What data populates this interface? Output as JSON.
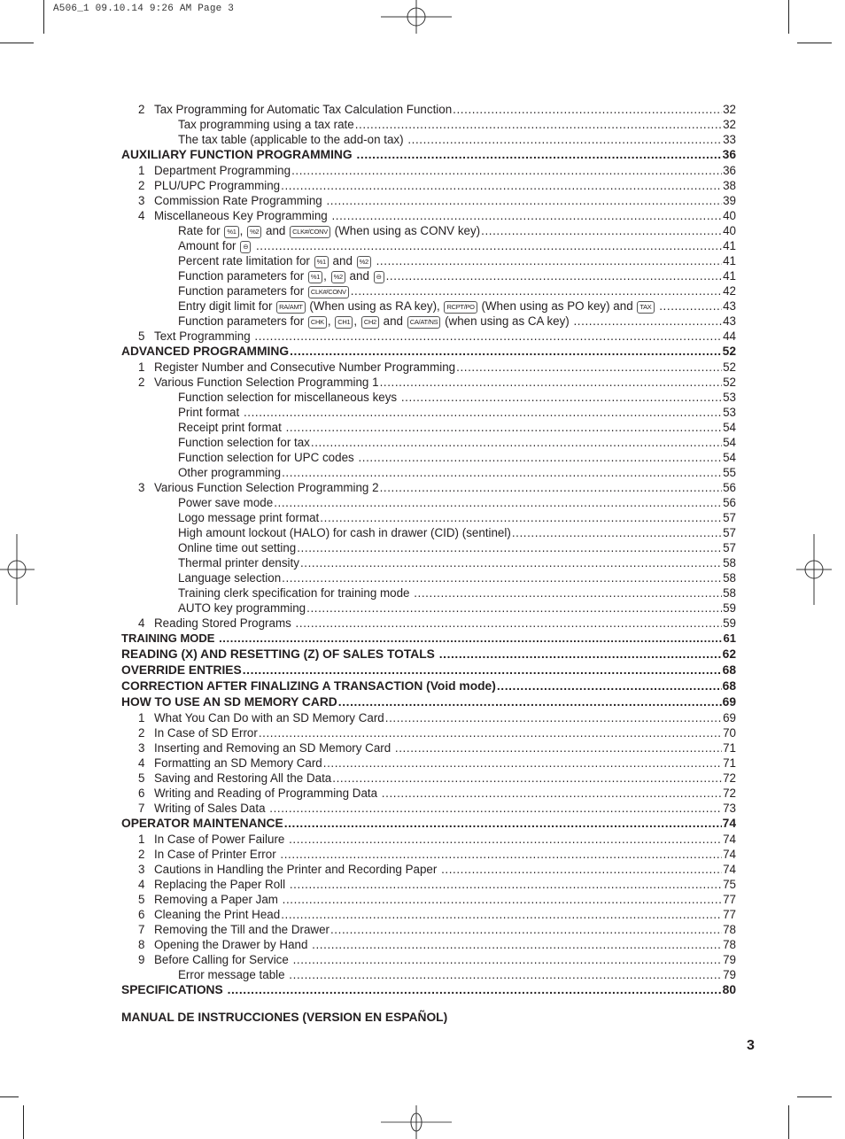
{
  "slug": "A506_1  09.10.14 9:26 AM  Page 3",
  "toc": [
    {
      "level": 1,
      "num": "2",
      "parts": [
        {
          "t": "Tax Programming for Automatic Tax Calculation Function"
        }
      ],
      "page": "32"
    },
    {
      "level": 2,
      "parts": [
        {
          "t": "Tax programming using a tax rate"
        }
      ],
      "page": "32"
    },
    {
      "level": 2,
      "parts": [
        {
          "t": "The tax table (applicable to the add-on tax) "
        }
      ],
      "page": "33"
    },
    {
      "level": 0,
      "parts": [
        {
          "t": "AUXILIARY FUNCTION PROGRAMMING "
        }
      ],
      "page": "36"
    },
    {
      "level": 1,
      "num": "1",
      "parts": [
        {
          "t": "Department Programming"
        }
      ],
      "page": "36"
    },
    {
      "level": 1,
      "num": "2",
      "parts": [
        {
          "t": "PLU/UPC Programming"
        }
      ],
      "page": "38"
    },
    {
      "level": 1,
      "num": "3",
      "parts": [
        {
          "t": "Commission Rate Programming "
        }
      ],
      "page": "39"
    },
    {
      "level": 1,
      "num": "4",
      "parts": [
        {
          "t": "Miscellaneous Key Programming "
        }
      ],
      "page": "40"
    },
    {
      "level": 2,
      "parts": [
        {
          "t": "Rate for "
        },
        {
          "k": "%1"
        },
        {
          "t": ", "
        },
        {
          "k": "%2"
        },
        {
          "t": " and "
        },
        {
          "k": "CLK#/CONV"
        },
        {
          "t": " (When using as CONV key)"
        }
      ],
      "page": "40"
    },
    {
      "level": 2,
      "parts": [
        {
          "t": "Amount for "
        },
        {
          "k": "⊖"
        },
        {
          "t": " "
        }
      ],
      "page": "41"
    },
    {
      "level": 2,
      "parts": [
        {
          "t": "Percent rate limitation for "
        },
        {
          "k": "%1"
        },
        {
          "t": " and "
        },
        {
          "k": "%2"
        },
        {
          "t": " "
        }
      ],
      "page": "41"
    },
    {
      "level": 2,
      "parts": [
        {
          "t": "Function parameters for "
        },
        {
          "k": "%1"
        },
        {
          "t": ", "
        },
        {
          "k": "%2"
        },
        {
          "t": " and "
        },
        {
          "k": "⊖"
        }
      ],
      "page": "41"
    },
    {
      "level": 2,
      "parts": [
        {
          "t": "Function parameters for "
        },
        {
          "k": "CLK#/CONV"
        }
      ],
      "page": "42"
    },
    {
      "level": 2,
      "parts": [
        {
          "t": "Entry digit limit for "
        },
        {
          "k": "RA/AMT"
        },
        {
          "t": " (When using as RA key), "
        },
        {
          "k": "RCPT/PO"
        },
        {
          "t": " (When using as PO key) and "
        },
        {
          "k": "TAX"
        },
        {
          "t": " "
        }
      ],
      "page": "43"
    },
    {
      "level": 2,
      "parts": [
        {
          "t": "Function parameters for "
        },
        {
          "k": "CHK"
        },
        {
          "t": ", "
        },
        {
          "k": "CH1"
        },
        {
          "t": ", "
        },
        {
          "k": "CH2"
        },
        {
          "t": " and "
        },
        {
          "k": "CA/AT/NS"
        },
        {
          "t": " (when using as CA key) "
        }
      ],
      "page": "43"
    },
    {
      "level": 1,
      "num": "5",
      "parts": [
        {
          "t": "Text Programming "
        }
      ],
      "page": "44"
    },
    {
      "level": 0,
      "parts": [
        {
          "t": "ADVANCED PROGRAMMING"
        }
      ],
      "page": "52"
    },
    {
      "level": 1,
      "num": "1",
      "parts": [
        {
          "t": "Register Number and Consecutive Number Programming"
        }
      ],
      "page": "52"
    },
    {
      "level": 1,
      "num": "2",
      "parts": [
        {
          "t": "Various Function Selection Programming 1"
        }
      ],
      "page": "52"
    },
    {
      "level": 2,
      "parts": [
        {
          "t": "Function selection for miscellaneous keys "
        }
      ],
      "page": "53"
    },
    {
      "level": 2,
      "parts": [
        {
          "t": "Print format "
        }
      ],
      "page": "53"
    },
    {
      "level": 2,
      "parts": [
        {
          "t": "Receipt print format "
        }
      ],
      "page": "54"
    },
    {
      "level": 2,
      "parts": [
        {
          "t": "Function selection for tax"
        }
      ],
      "page": "54"
    },
    {
      "level": 2,
      "parts": [
        {
          "t": "Function selection for UPC codes "
        }
      ],
      "page": "54"
    },
    {
      "level": 2,
      "parts": [
        {
          "t": "Other programming"
        }
      ],
      "page": "55"
    },
    {
      "level": 1,
      "num": "3",
      "parts": [
        {
          "t": "Various Function Selection Programming 2"
        }
      ],
      "page": "56"
    },
    {
      "level": 2,
      "parts": [
        {
          "t": "Power save mode"
        }
      ],
      "page": "56"
    },
    {
      "level": 2,
      "parts": [
        {
          "t": "Logo message print format"
        }
      ],
      "page": "57"
    },
    {
      "level": 2,
      "parts": [
        {
          "t": "High amount lockout (HALO) for cash in drawer (CID) (sentinel)"
        }
      ],
      "page": "57"
    },
    {
      "level": 2,
      "parts": [
        {
          "t": "Online time out setting"
        }
      ],
      "page": "57"
    },
    {
      "level": 2,
      "parts": [
        {
          "t": "Thermal printer density"
        }
      ],
      "page": "58"
    },
    {
      "level": 2,
      "parts": [
        {
          "t": "Language selection"
        }
      ],
      "page": "58"
    },
    {
      "level": 2,
      "parts": [
        {
          "t": "Training clerk specification for training mode "
        }
      ],
      "page": "58"
    },
    {
      "level": 2,
      "parts": [
        {
          "t": "AUTO key programming"
        }
      ],
      "page": "59"
    },
    {
      "level": 1,
      "num": "4",
      "parts": [
        {
          "t": "Reading Stored Programs "
        }
      ],
      "page": "59"
    },
    {
      "level": 0,
      "small": true,
      "parts": [
        {
          "t": "TRAINING MODE "
        }
      ],
      "page": "61"
    },
    {
      "level": 0,
      "parts": [
        {
          "t": "READING (X) AND RESETTING (Z) OF SALES TOTALS "
        }
      ],
      "page": "62"
    },
    {
      "level": 0,
      "parts": [
        {
          "t": "OVERRIDE ENTRIES"
        }
      ],
      "page": "68"
    },
    {
      "level": 0,
      "parts": [
        {
          "t": "CORRECTION AFTER FINALIZING A TRANSACTION (Void mode)"
        }
      ],
      "page": "68"
    },
    {
      "level": 0,
      "parts": [
        {
          "t": "HOW TO USE AN SD MEMORY CARD"
        }
      ],
      "page": "69"
    },
    {
      "level": 1,
      "num": "1",
      "parts": [
        {
          "t": "What You Can Do with an SD Memory Card"
        }
      ],
      "page": "69"
    },
    {
      "level": 1,
      "num": "2",
      "parts": [
        {
          "t": "In Case of SD Error"
        }
      ],
      "page": "70"
    },
    {
      "level": 1,
      "num": "3",
      "parts": [
        {
          "t": "Inserting and Removing an SD Memory Card "
        }
      ],
      "page": "71"
    },
    {
      "level": 1,
      "num": "4",
      "parts": [
        {
          "t": "Formatting an SD Memory Card"
        }
      ],
      "page": "71"
    },
    {
      "level": 1,
      "num": "5",
      "parts": [
        {
          "t": "Saving and Restoring All the Data"
        }
      ],
      "page": "72"
    },
    {
      "level": 1,
      "num": "6",
      "parts": [
        {
          "t": "Writing and Reading of Programming Data "
        }
      ],
      "page": "72"
    },
    {
      "level": 1,
      "num": "7",
      "parts": [
        {
          "t": "Writing of Sales Data "
        }
      ],
      "page": "73"
    },
    {
      "level": 0,
      "parts": [
        {
          "t": "OPERATOR MAINTENANCE"
        }
      ],
      "page": "74"
    },
    {
      "level": 1,
      "num": "1",
      "parts": [
        {
          "t": "In Case of Power Failure "
        }
      ],
      "page": "74"
    },
    {
      "level": 1,
      "num": "2",
      "parts": [
        {
          "t": "In Case of Printer Error "
        }
      ],
      "page": "74"
    },
    {
      "level": 1,
      "num": "3",
      "parts": [
        {
          "t": "Cautions in Handling the Printer and Recording Paper "
        }
      ],
      "page": "74"
    },
    {
      "level": 1,
      "num": "4",
      "parts": [
        {
          "t": "Replacing the Paper Roll "
        }
      ],
      "page": "75"
    },
    {
      "level": 1,
      "num": "5",
      "parts": [
        {
          "t": "Removing a Paper Jam "
        }
      ],
      "page": "77"
    },
    {
      "level": 1,
      "num": "6",
      "parts": [
        {
          "t": "Cleaning the Print Head"
        }
      ],
      "page": "77"
    },
    {
      "level": 1,
      "num": "7",
      "parts": [
        {
          "t": "Removing the Till and the Drawer"
        }
      ],
      "page": "78"
    },
    {
      "level": 1,
      "num": "8",
      "parts": [
        {
          "t": "Opening the Drawer by Hand "
        }
      ],
      "page": "78"
    },
    {
      "level": 1,
      "num": "9",
      "parts": [
        {
          "t": "Before Calling for Service "
        }
      ],
      "page": "79"
    },
    {
      "level": 2,
      "parts": [
        {
          "t": "Error message table "
        }
      ],
      "page": "79"
    },
    {
      "level": 0,
      "parts": [
        {
          "t": "SPECIFICATIONS "
        }
      ],
      "page": "80"
    }
  ],
  "spanish_heading": "MANUAL DE INSTRUCCIONES (VERSION EN ESPAÑOL)",
  "page_number": "3"
}
